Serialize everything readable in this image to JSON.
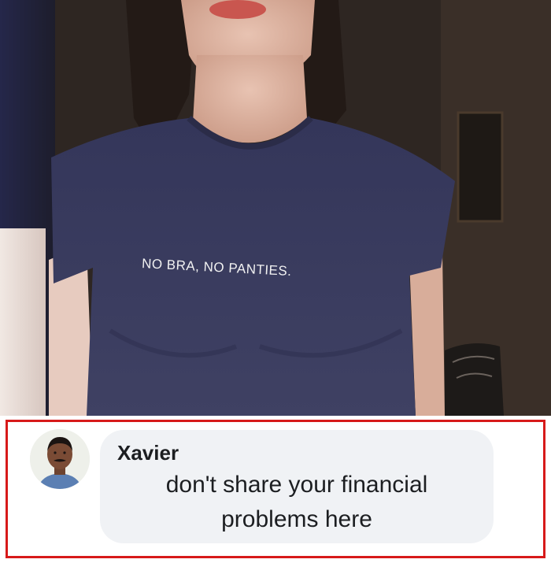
{
  "photo": {
    "shirt_text": "NO BRA, NO PANTIES."
  },
  "comment": {
    "author": "Xavier",
    "text": "don't share your financial\nproblems here",
    "avatar_icon": "person-avatar-icon"
  },
  "colors": {
    "frame_border": "#d71a1a",
    "bubble_bg": "#f0f2f5",
    "shirt": "#3a3c5a"
  }
}
